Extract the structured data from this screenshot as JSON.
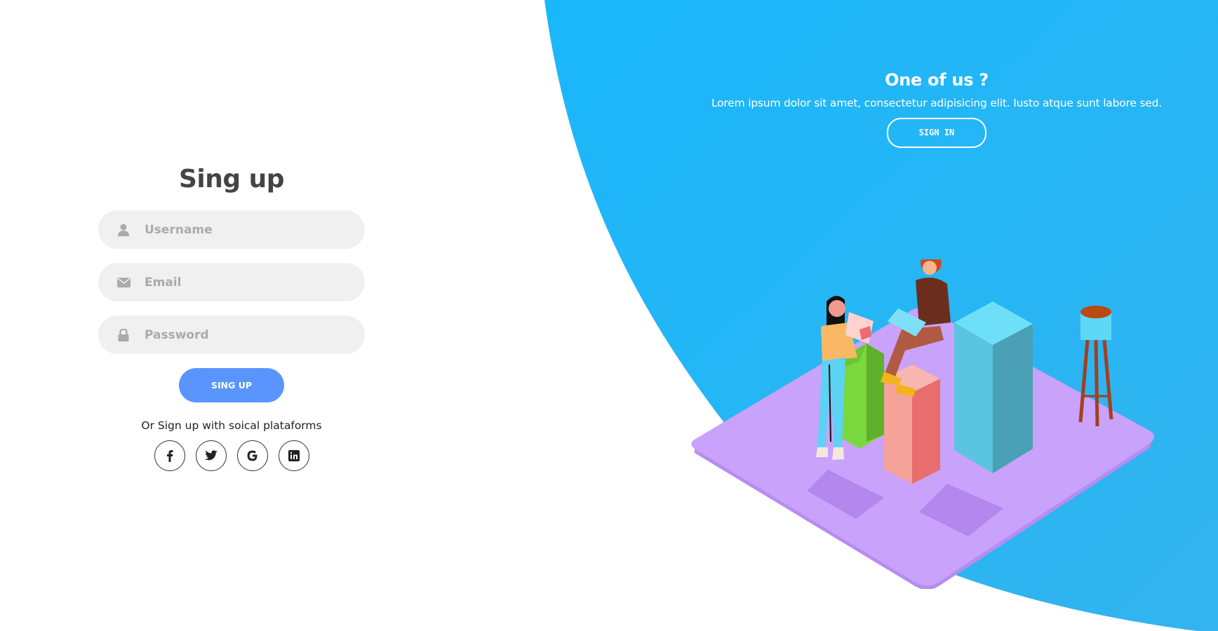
{
  "colors": {
    "panel_blue": "#1eb9f8",
    "button_blue": "#5995fd",
    "input_bg": "#f0f0f0",
    "title_gray": "#444444"
  },
  "signup": {
    "title": "Sing up",
    "fields": [
      {
        "icon": "user-icon",
        "placeholder": "Username"
      },
      {
        "icon": "envelope-icon",
        "placeholder": "Email"
      },
      {
        "icon": "lock-icon",
        "placeholder": "Password"
      }
    ],
    "submit_label": "SING UP",
    "social_text": "Or Sign up with soical plataforms",
    "social_icons": [
      "facebook-icon",
      "twitter-icon",
      "google-icon",
      "linkedin-icon"
    ]
  },
  "promo": {
    "title": "One of us ?",
    "text": "Lorem ipsum dolor sit amet, consectetur adipisicing elit. Iusto atque sunt labore sed.",
    "button_label": "SIGN IN"
  }
}
